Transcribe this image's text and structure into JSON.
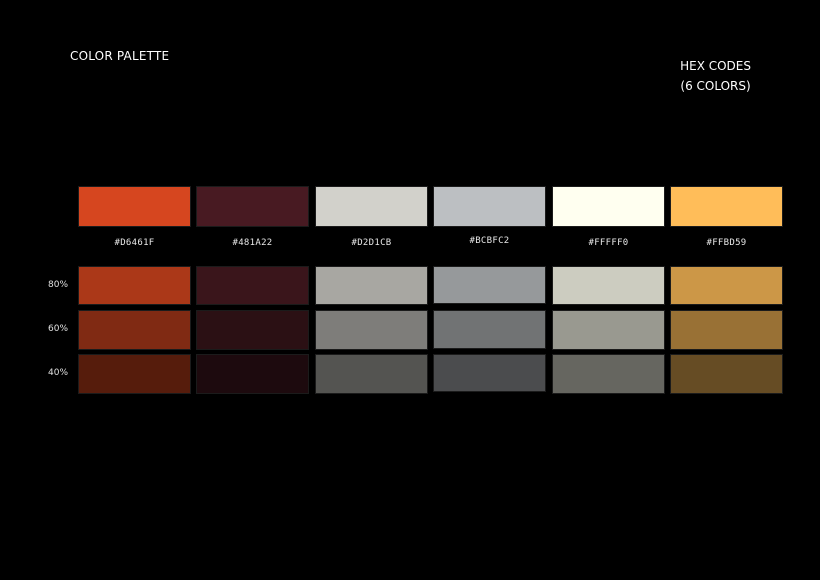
{
  "header": {
    "title": "COLOR PALETTE",
    "hex_title_line1": "HEX CODES",
    "hex_title_line2": "(6 COLORS)"
  },
  "colors": [
    {
      "code": "#D6461F",
      "base": "#D6461F",
      "s80": "#AB3818",
      "s60": "#802A13",
      "s40": "#561C0C"
    },
    {
      "code": "#481A22",
      "base": "#481A22",
      "s80": "#3A151B",
      "s60": "#2B1014",
      "s40": "#1D0A0E"
    },
    {
      "code": "#D2D1CB",
      "base": "#D2D1CB",
      "s80": "#A8A7A2",
      "s60": "#7E7D7A",
      "s40": "#545451"
    },
    {
      "code": "#BCBFC2",
      "base": "#BCBFC2",
      "s80": "#96999B",
      "s60": "#717374",
      "s40": "#4B4C4E"
    },
    {
      "code": "#FFFFF0",
      "base": "#FFFFF0",
      "s80": "#CCCCC0",
      "s60": "#999990",
      "s40": "#666660"
    },
    {
      "code": "#FFBD59",
      "base": "#FFBD59",
      "s80": "#CC9747",
      "s60": "#997135",
      "s40": "#664C24"
    }
  ],
  "shade_labels": {
    "s80": "80%",
    "s60": "60%",
    "s40": "40%"
  }
}
